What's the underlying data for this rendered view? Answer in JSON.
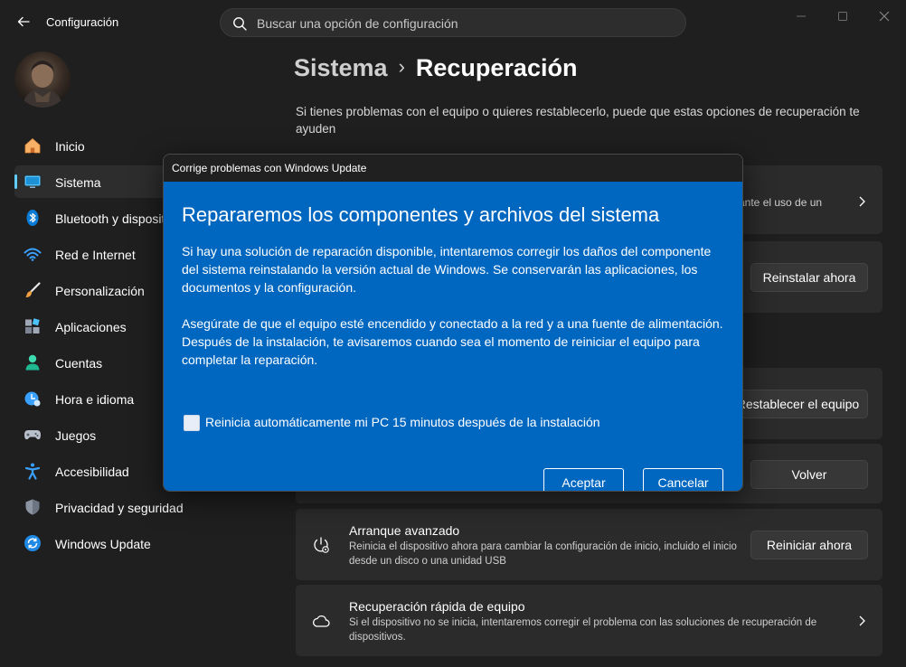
{
  "app": {
    "title": "Configuración"
  },
  "search": {
    "placeholder": "Buscar una opción de configuración"
  },
  "sidebar": {
    "items": [
      {
        "label": "Inicio",
        "icon": "home-icon"
      },
      {
        "label": "Sistema",
        "icon": "monitor-icon",
        "active": true
      },
      {
        "label": "Bluetooth y dispositivos",
        "icon": "bluetooth-icon"
      },
      {
        "label": "Red e Internet",
        "icon": "wifi-icon"
      },
      {
        "label": "Personalización",
        "icon": "brush-icon"
      },
      {
        "label": "Aplicaciones",
        "icon": "apps-icon"
      },
      {
        "label": "Cuentas",
        "icon": "account-icon"
      },
      {
        "label": "Hora e idioma",
        "icon": "clock-globe-icon"
      },
      {
        "label": "Juegos",
        "icon": "gamepad-icon"
      },
      {
        "label": "Accesibilidad",
        "icon": "accessibility-icon"
      },
      {
        "label": "Privacidad y seguridad",
        "icon": "shield-icon"
      },
      {
        "label": "Windows Update",
        "icon": "update-icon"
      }
    ]
  },
  "main": {
    "breadcrumb_parent": "Sistema",
    "breadcrumb_current": "Recuperación",
    "intro": "Si tienes problemas con el equipo o quieres restablecerlo, puede que estas opciones de recuperación te ayuden",
    "cards": {
      "fix_partial": "ante el uso de un",
      "reinstall_button": "Reinstalar ahora",
      "reset_button": "Restablecer el equipo",
      "goback_button": "Volver",
      "advanced_title": "Arranque avanzado",
      "advanced_desc": "Reinicia el dispositivo ahora para cambiar la configuración de inicio, incluido el inicio desde un disco o una unidad USB",
      "advanced_button": "Reiniciar ahora",
      "quick_title": "Recuperación rápida de equipo",
      "quick_desc": "Si el dispositivo no se inicia, intentaremos corregir el problema con las soluciones de recuperación de dispositivos."
    }
  },
  "dialog": {
    "title": "Corrige problemas con Windows Update",
    "heading": "Repararemos los componentes y archivos del sistema",
    "paragraph1": "Si hay una solución de reparación disponible, intentaremos corregir los daños del componente del sistema reinstalando la versión actual de Windows. Se conservarán las aplicaciones, los documentos y la configuración.",
    "paragraph2": "Asegúrate de que el equipo esté encendido y conectado a la red y a una fuente de alimentación. Después de la instalación, te avisaremos cuando sea el momento de reiniciar el equipo para completar la reparación.",
    "checkbox_label": "Reinicia automáticamente mi PC 15 minutos después de la instalación",
    "checkbox_checked": false,
    "accept_label": "Aceptar",
    "cancel_label": "Cancelar"
  },
  "colors": {
    "accent": "#60cdff",
    "dialog_blue": "#0067c0",
    "background": "#1f1f1f",
    "card": "#2b2b2b"
  }
}
